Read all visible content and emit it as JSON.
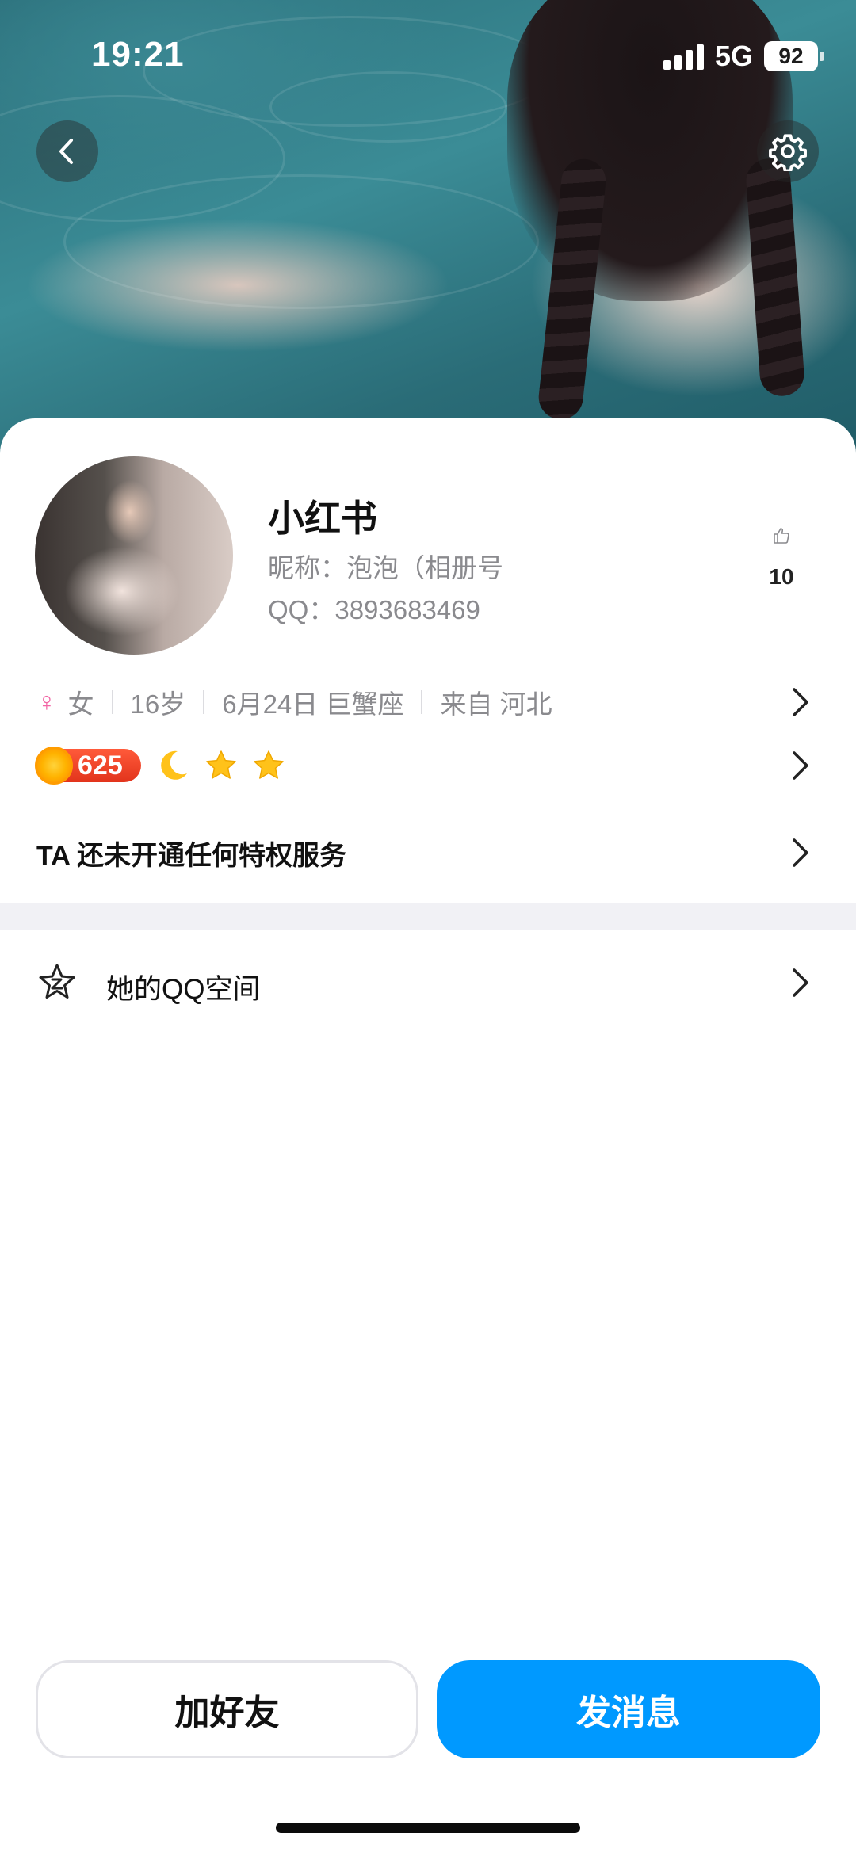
{
  "status_bar": {
    "time": "19:21",
    "network": "5G",
    "battery": "92"
  },
  "cover": {
    "description_icons": [
      "back-icon",
      "gear-icon"
    ]
  },
  "profile": {
    "name": "小红书",
    "nickname": "昵称：泡泡（相册号",
    "qq": "QQ：3893683469",
    "likes": "10"
  },
  "info": {
    "gender_symbol": "♀",
    "gender": "女",
    "age": "16岁",
    "birthday": "6月24日 巨蟹座",
    "location": "来自 河北"
  },
  "badges": {
    "level": "625",
    "icons": [
      "moon-icon",
      "star-icon",
      "star-icon"
    ]
  },
  "privilege": {
    "text": "TA 还未开通任何特权服务"
  },
  "qzone": {
    "label": "她的QQ空间"
  },
  "actions": {
    "add_friend": "加好友",
    "send_message": "发消息"
  },
  "colors": {
    "primary": "#0099ff",
    "female": "#f266a5",
    "level_badge": "#e2341c",
    "secondary_text": "#8a8a8e"
  }
}
